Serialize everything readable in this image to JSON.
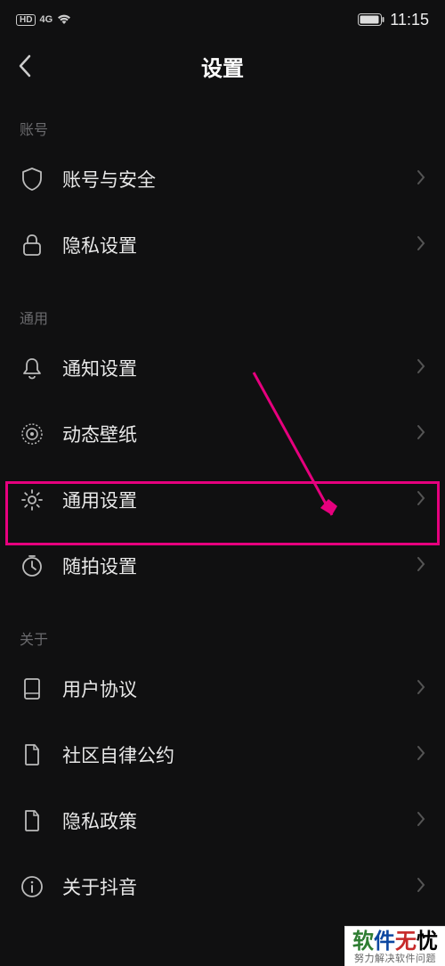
{
  "status": {
    "hd": "HD",
    "network": "4G",
    "time": "11:15"
  },
  "header": {
    "title": "设置"
  },
  "sections": {
    "account": {
      "label": "账号"
    },
    "general": {
      "label": "通用"
    },
    "about": {
      "label": "关于"
    }
  },
  "items": {
    "account_security": "账号与安全",
    "privacy_settings": "隐私设置",
    "notification_settings": "通知设置",
    "dynamic_wallpaper": "动态壁纸",
    "general_settings": "通用设置",
    "suipai_settings": "随拍设置",
    "user_agreement": "用户协议",
    "community_convention": "社区自律公约",
    "privacy_policy": "隐私政策",
    "about_douyin": "关于抖音"
  },
  "watermark": {
    "c1": "软",
    "c2": "件",
    "c3": "无",
    "c4": "忧",
    "sub": "努力解决软件问题"
  },
  "annotation": {
    "highlight_color": "#e6007e"
  }
}
